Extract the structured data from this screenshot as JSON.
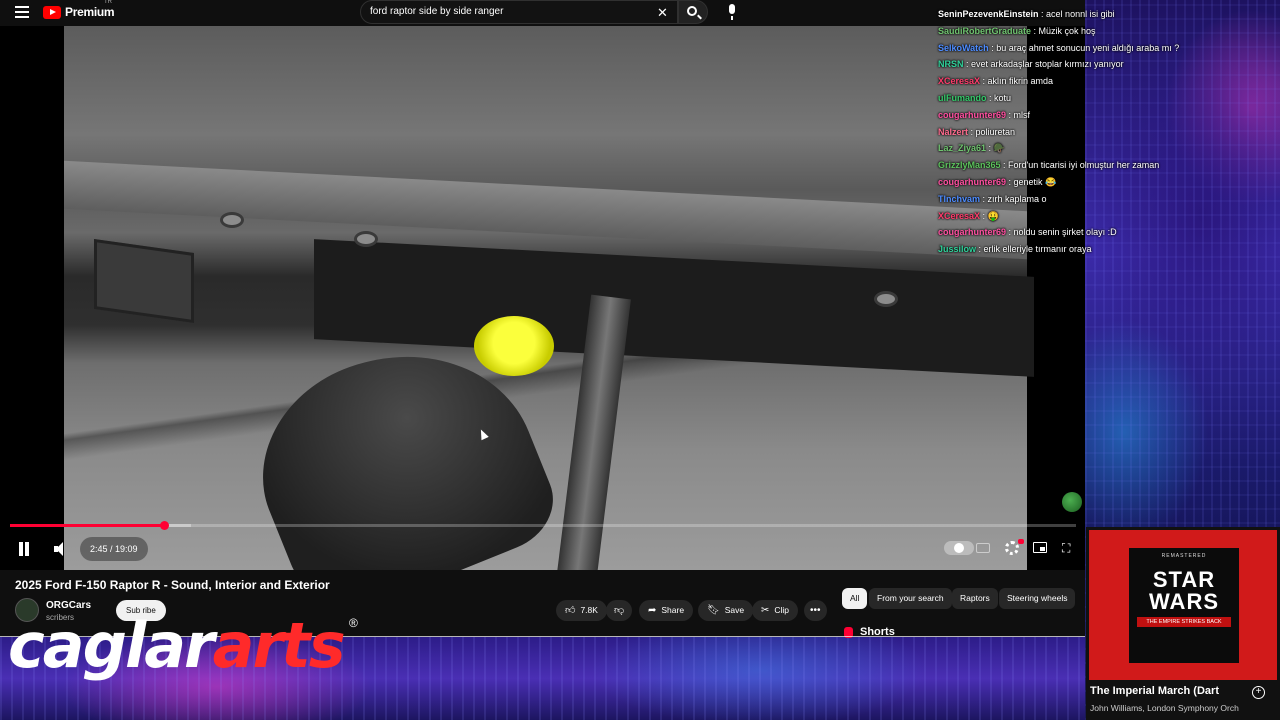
{
  "header": {
    "logo_text": "Premium",
    "logo_sup": "TR",
    "search": {
      "value": "ford raptor side by side ranger"
    }
  },
  "chat": [
    {
      "user": "SeninPezevenkEinstein",
      "color": "#ffffff",
      "message": "acel nonnl isi gibi"
    },
    {
      "user": "SaudiRobertGraduate",
      "color": "#6fc36f",
      "message": "Müzik çok hoş"
    },
    {
      "user": "SelkoWatch",
      "color": "#4d8cff",
      "message": "bu araç ahmet sonucun yeni aldığı araba mı ?"
    },
    {
      "user": "NRSN",
      "color": "#2fd19a",
      "message": "evet arkadaşlar stoplar kırmızı yanıyor"
    },
    {
      "user": "XCeresaX",
      "color": "#ff3b6b",
      "message": "aklın fikrin amda"
    },
    {
      "user": "ulFumando",
      "color": "#34c96a",
      "message": "kotu"
    },
    {
      "user": "cougarhunter69",
      "color": "#ff4fa0",
      "message": "mlsf"
    },
    {
      "user": "Nalzert",
      "color": "#ff6b8e",
      "message": "poliuretan"
    },
    {
      "user": "Laz_Ziya61",
      "color": "#6fc36f",
      "message": "🪖"
    },
    {
      "user": "GrizzlyMan365",
      "color": "#5cc25c",
      "message": "Ford'un ticarisi iyi olmuştur her zaman"
    },
    {
      "user": "cougarhunter69",
      "color": "#ff4fa0",
      "message": "genetik 😂"
    },
    {
      "user": "Tlnchvam",
      "color": "#4d8cff",
      "message": "zırh kaplama o"
    },
    {
      "user": "XCeresaX",
      "color": "#ff3b6b",
      "message": "🤑"
    },
    {
      "user": "cougarhunter69",
      "color": "#ff4fa0",
      "message": "noldu senin şirket olayı :D"
    },
    {
      "user": "Jussilow",
      "color": "#2fd19a",
      "message": "erlik elleriyle tırmanır oraya"
    }
  ],
  "player": {
    "time": "2:45 / 19:09",
    "progress_fraction": 0.144,
    "buffer_fraction": 0.17,
    "accent": "#ff0033"
  },
  "video": {
    "title": "2025 Ford F-150 Raptor R - Sound, Interior and Exterior",
    "channel": "ORGCars",
    "subscribers": "scribers",
    "subscribe_label": "Sub  ribe",
    "likes": "7.8K",
    "share_label": "Share",
    "save_label": "Save",
    "clip_label": "Clip"
  },
  "chips": [
    "All",
    "From your search",
    "Raptors",
    "Steering wheels"
  ],
  "shorts_label": "Shorts",
  "watermark": {
    "part1": "caglar",
    "part2": "arts",
    "reg": "®"
  },
  "music": {
    "title": "The Imperial March (Dart",
    "artist": "John Williams, London Symphony Orch",
    "album_remastered": "REMASTERED",
    "album_logo": "STAR WARS",
    "album_subtitle": "THE EMPIRE STRIKES BACK"
  }
}
